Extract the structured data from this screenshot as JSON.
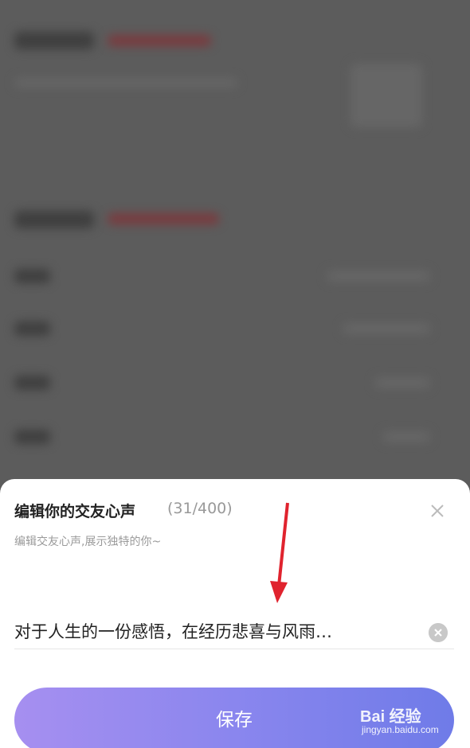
{
  "sheet": {
    "title": "编辑你的交友心声",
    "count": "(31/400)",
    "subtitle": "编辑交友心声,展示独特的你~",
    "input_value": "对于人生的一份感悟，在经历悲喜与风雨…",
    "save_label": "保存"
  },
  "watermark": {
    "logo": "Bai 经验",
    "sub": "jingyan.baidu.com"
  },
  "colors": {
    "overlay": "#5c5c5c",
    "accent_start": "#a68ff0",
    "accent_end": "#6f7be8",
    "annotation_arrow": "#e0232e"
  },
  "icons": [
    "close-icon",
    "clear-icon",
    "arrow-annotation"
  ]
}
